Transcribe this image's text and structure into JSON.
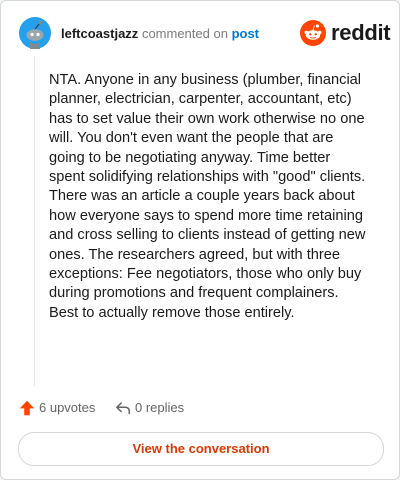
{
  "header": {
    "username": "leftcoastjazz",
    "action_text": "commented on",
    "post_link": "post",
    "brand": "reddit"
  },
  "comment": {
    "body": "NTA. Anyone in any business (plumber, financial planner, electrician, carpenter, accountant, etc) has to set value their own work otherwise no one will. You don't even want the people that are going to be negotiating anyway. Time better spent solidifying relationships with \"good\" clients. There was an article a couple years back about how everyone says to spend more time retaining and cross selling to clients instead of getting new ones. The researchers agreed, but with three exceptions: Fee negotiators, those who only buy during promotions and frequent complainers. Best to actually remove those entirely."
  },
  "actions": {
    "upvotes": "6 upvotes",
    "replies": "0 replies"
  },
  "cta": {
    "label": "View the conversation"
  },
  "icons": {
    "avatar": "snoo-avatar-icon",
    "brand": "reddit-logo-icon",
    "upvote": "upvote-arrow-icon",
    "reply": "reply-arrow-icon"
  },
  "colors": {
    "brand_orange": "#ff4500",
    "link_blue": "#0079d3",
    "cta_text": "#d93a00",
    "avatar_bg": "#24a0ed"
  }
}
